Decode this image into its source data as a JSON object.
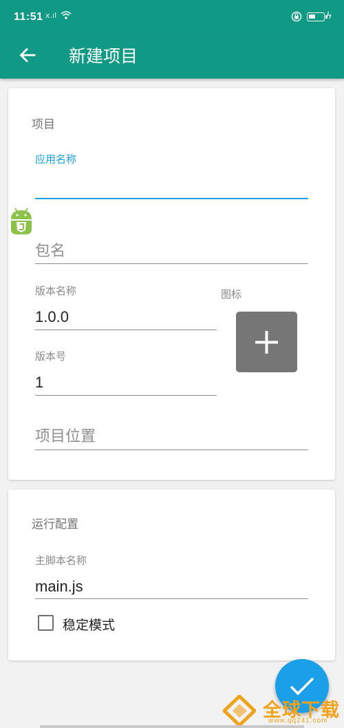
{
  "status_bar": {
    "time": "11:51",
    "signal": "x.ıl",
    "colors": {
      "bar": "#109a85"
    }
  },
  "toolbar": {
    "title": "新建项目",
    "back_icon": "arrow-left-icon"
  },
  "project_section": {
    "title": "项目",
    "app_name": {
      "label": "应用名称",
      "value": ""
    },
    "package_name": {
      "placeholder": "包名",
      "value": ""
    },
    "version_name": {
      "label": "版本名称",
      "value": "1.0.0"
    },
    "version_code": {
      "label": "版本号",
      "value": "1"
    },
    "project_location": {
      "placeholder": "项目位置",
      "value": ""
    },
    "icon": {
      "label": "图标",
      "add_icon": "plus-icon"
    }
  },
  "run_section": {
    "title": "运行配置",
    "main_script": {
      "label": "主脚本名称",
      "value": "main.js"
    },
    "stable_mode": {
      "label": "稳定模式",
      "checked": false
    }
  },
  "fab": {
    "icon": "check-icon"
  },
  "watermark": {
    "text": "全球下载",
    "url": "www.qq241.com"
  },
  "colors": {
    "primary": "#109a85",
    "accent": "#1aa4e4",
    "fab": "#1a9fe8",
    "icon_button": "#767676"
  }
}
